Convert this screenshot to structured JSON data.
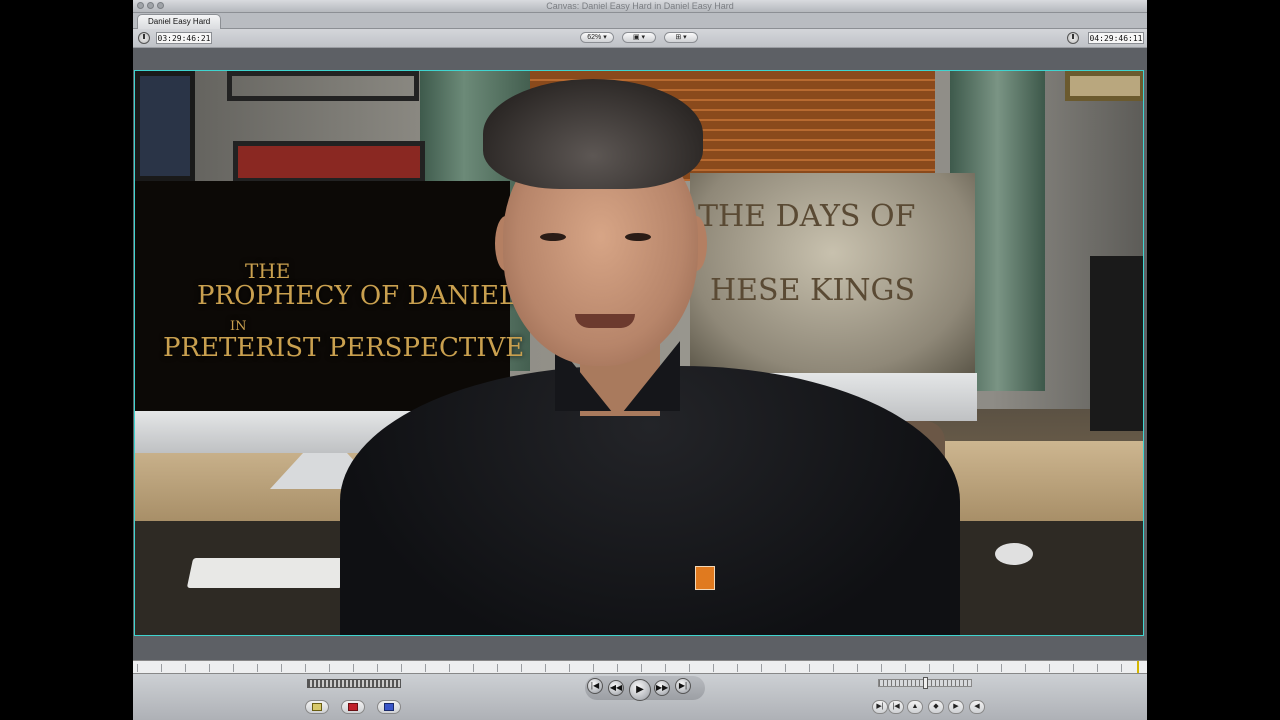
{
  "window": {
    "title": "Canvas: Daniel Easy Hard in Daniel Easy Hard",
    "tab": "Daniel Easy Hard"
  },
  "controls": {
    "timecode_duration": "03:29:46:21",
    "zoom": "62%",
    "view_mode_icon": "overlay-icon",
    "fit_icon": "frame-icon",
    "timecode_current": "04:29:46:11"
  },
  "video": {
    "left_screen_title_line1": "THE",
    "left_screen_title_line2": "PROPHECY OF DANIEL",
    "left_screen_title_line3": "IN",
    "left_screen_title_line4": "PRETERIST PERSPECTIVE",
    "right_screen_title_line1": "THE DAYS OF",
    "right_screen_title_line2": "HESE KINGS"
  },
  "transport": {
    "buttons": [
      "go-to-previous-edit",
      "play-in-to-out",
      "play",
      "play-around-current",
      "go-to-next-edit"
    ],
    "play_glyph": "▶",
    "prev_glyph": "|◀",
    "next_glyph": "▶|",
    "step_back_glyph": "◀◀",
    "step_fwd_glyph": "▶▶"
  },
  "colors": {
    "video_border": "#3fd5d0",
    "in_marker": "#d4b600",
    "out_marker": "#c0202a"
  }
}
